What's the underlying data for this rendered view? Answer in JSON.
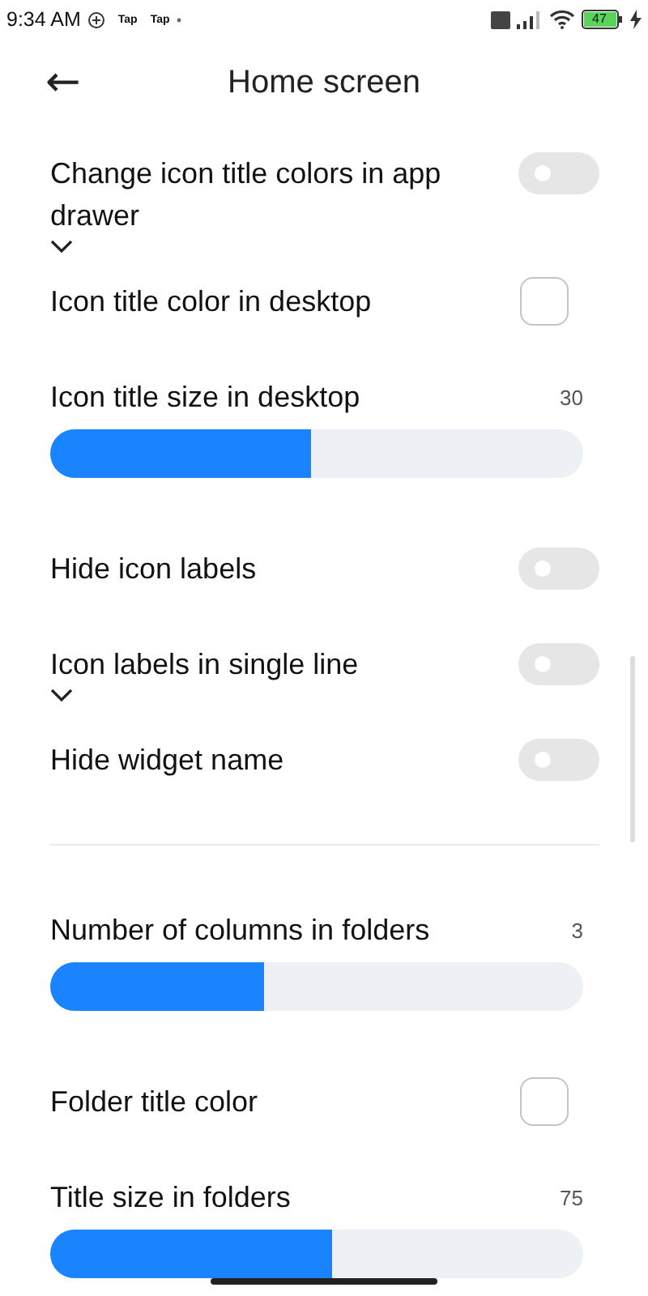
{
  "status_bar": {
    "time": "9:34 AM",
    "notifications": [
      "Tap",
      "Tap"
    ],
    "battery": "47"
  },
  "header": {
    "back": "←",
    "title": "Home screen"
  },
  "items": [
    {
      "kind": "toggle",
      "label": "Change icon title colors in app drawer",
      "on": false,
      "chevron": true
    },
    {
      "kind": "color",
      "label": "Icon title color in desktop",
      "color": "#ffffff"
    },
    {
      "kind": "slider",
      "label": "Icon title size in desktop",
      "value": "30",
      "level": 0.49
    },
    {
      "kind": "toggle",
      "label": "Hide icon labels",
      "on": false,
      "chevron": false
    },
    {
      "kind": "toggle",
      "label": "Icon labels in single line",
      "on": false,
      "chevron": true
    },
    {
      "kind": "toggle",
      "label": "Hide widget name",
      "on": false,
      "chevron": false
    },
    {
      "kind": "divider"
    },
    {
      "kind": "slider",
      "label": "Number of columns in folders",
      "value": "3",
      "level": 0.4
    },
    {
      "kind": "color",
      "label": "Folder title color",
      "color": "#ffffff"
    },
    {
      "kind": "slider",
      "label": "Title size in folders",
      "value": "75",
      "level": 0.53
    }
  ]
}
